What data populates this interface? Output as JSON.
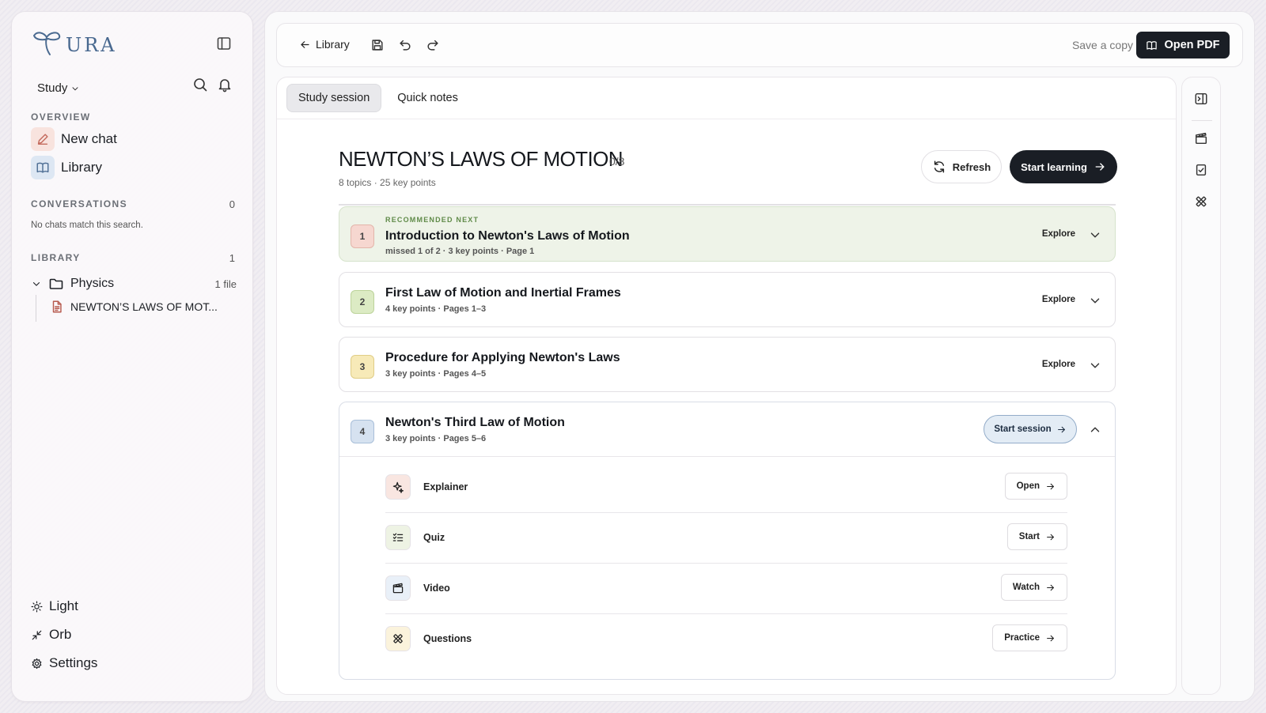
{
  "sidebar": {
    "logo_text": "URA",
    "study_label": "Study",
    "overview_label": "OVERVIEW",
    "new_chat_label": "New chat",
    "library_nav_label": "Library",
    "conversations_label": "CONVERSATIONS",
    "conversations_count": "0",
    "empty_note": "No chats match this search.",
    "library_label": "LIBRARY",
    "library_count": "1",
    "folder_name": "Physics",
    "folder_files": "1 file",
    "file_name": "NEWTON’S LAWS OF MOT...",
    "bottom": {
      "light_label": "Light",
      "orb_label": "Orb",
      "settings_label": "Settings"
    }
  },
  "toolbar": {
    "back_label": "Library",
    "save_copy_label": "Save a copy",
    "open_pdf_label": "Open PDF"
  },
  "tabs": [
    {
      "label": "Study session",
      "active": true
    },
    {
      "label": "Quick notes",
      "active": false
    }
  ],
  "doc": {
    "title": "NEWTON’S LAWS OF MOTION",
    "progress": "0/8",
    "meta": "8 topics · 25 key points",
    "refresh_label": "Refresh",
    "start_learning_label": "Start learning"
  },
  "topics": [
    {
      "num": "1",
      "rec_label": "RECOMMENDED NEXT",
      "title": "Introduction to Newton's Laws of Motion",
      "meta": "missed 1 of 2 · 3 key points · Page 1",
      "action": "Explore"
    },
    {
      "num": "2",
      "title": "First Law of Motion and Inertial Frames",
      "meta": "4 key points · Pages 1–3",
      "action": "Explore"
    },
    {
      "num": "3",
      "title": "Procedure for Applying Newton's Laws",
      "meta": "3 key points · Pages 4–5",
      "action": "Explore"
    },
    {
      "num": "4",
      "title": "Newton's Third Law of Motion",
      "meta": "3 key points · Pages 5–6",
      "action": "Start session"
    }
  ],
  "resources": [
    {
      "label": "Explainer",
      "action": "Open"
    },
    {
      "label": "Quiz",
      "action": "Start"
    },
    {
      "label": "Video",
      "action": "Watch"
    },
    {
      "label": "Questions",
      "action": "Practice"
    }
  ],
  "colors": {
    "accent_dark": "#1a1e25",
    "num1_bg": "#f6d7d0",
    "num2_bg": "#dcebc4",
    "num3_bg": "#f7eab8",
    "num4_bg": "#d6e2f0"
  }
}
